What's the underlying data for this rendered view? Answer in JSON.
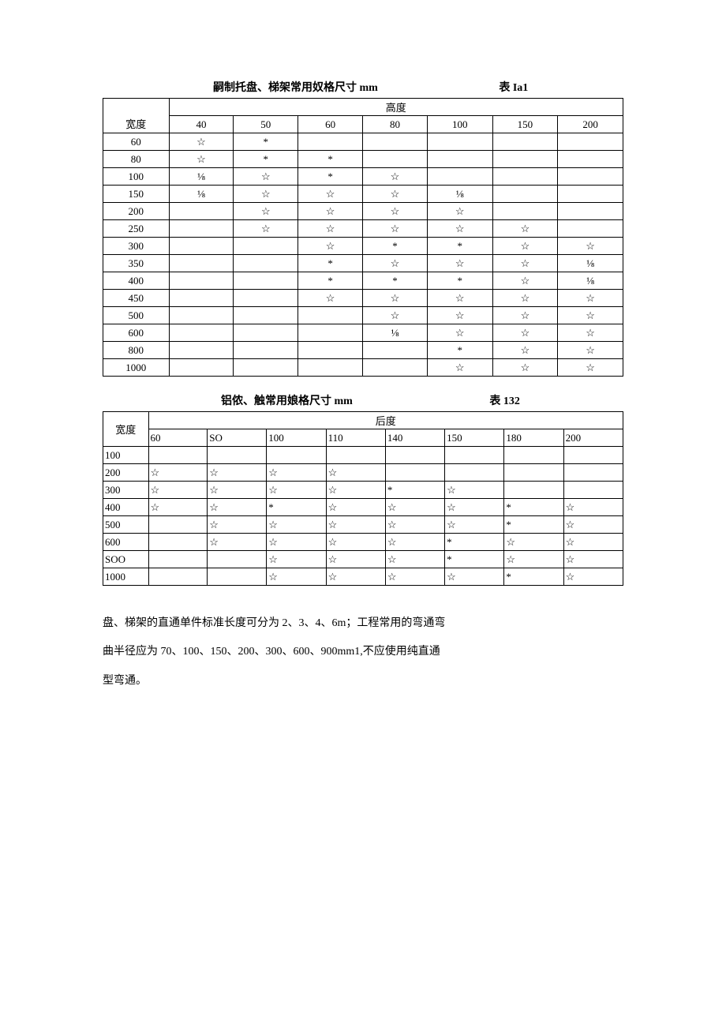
{
  "table1": {
    "title": "嗣制托盘、梯架常用奴格尺寸 mm",
    "label": "表 Ia1",
    "row_header_label": "宽度",
    "col_group_label": "高度",
    "columns": [
      "40",
      "50",
      "60",
      "80",
      "100",
      "150",
      "200"
    ],
    "rows": [
      {
        "w": "60",
        "c": [
          "☆",
          "*",
          "",
          "",
          "",
          "",
          ""
        ]
      },
      {
        "w": "80",
        "c": [
          "☆",
          "*",
          "*",
          "",
          "",
          "",
          ""
        ]
      },
      {
        "w": "100",
        "c": [
          "⅛",
          "☆",
          "*",
          "☆",
          "",
          "",
          ""
        ]
      },
      {
        "w": "150",
        "c": [
          "⅛",
          "☆",
          "☆",
          "☆",
          "⅛",
          "",
          ""
        ]
      },
      {
        "w": "200",
        "c": [
          "",
          "☆",
          "☆",
          "☆",
          "☆",
          "",
          ""
        ]
      },
      {
        "w": "250",
        "c": [
          "",
          "☆",
          "☆",
          "☆",
          "☆",
          "☆",
          ""
        ]
      },
      {
        "w": "300",
        "c": [
          "",
          "",
          "☆",
          "*",
          "*",
          "☆",
          "☆"
        ]
      },
      {
        "w": "350",
        "c": [
          "",
          "",
          "*",
          "☆",
          "☆",
          "☆",
          "⅛"
        ]
      },
      {
        "w": "400",
        "c": [
          "",
          "",
          "*",
          "*",
          "*",
          "☆",
          "⅛"
        ]
      },
      {
        "w": "450",
        "c": [
          "",
          "",
          "☆",
          "☆",
          "☆",
          "☆",
          "☆"
        ]
      },
      {
        "w": "500",
        "c": [
          "",
          "",
          "",
          "☆",
          "☆",
          "☆",
          "☆"
        ]
      },
      {
        "w": "600",
        "c": [
          "",
          "",
          "",
          "⅛",
          "☆",
          "☆",
          "☆"
        ]
      },
      {
        "w": "800",
        "c": [
          "",
          "",
          "",
          "",
          "*",
          "☆",
          "☆"
        ]
      },
      {
        "w": "1000",
        "c": [
          "",
          "",
          "",
          "",
          "☆",
          "☆",
          "☆"
        ]
      }
    ]
  },
  "table2": {
    "title": "铝侬、触常用娘格尺寸 mm",
    "label": "表 132",
    "row_header_label": "宽度",
    "col_group_label": "后度",
    "columns": [
      "60",
      "SO",
      "100",
      "110",
      "140",
      "150",
      "180",
      "200"
    ],
    "rows": [
      {
        "w": "100",
        "c": [
          "",
          "",
          "",
          "",
          "",
          "",
          "",
          ""
        ]
      },
      {
        "w": "200",
        "c": [
          "☆",
          "☆",
          "☆",
          "☆",
          "",
          "",
          "",
          ""
        ]
      },
      {
        "w": "300",
        "c": [
          "☆",
          "☆",
          "☆",
          "☆",
          "*",
          "☆",
          "",
          ""
        ]
      },
      {
        "w": "400",
        "c": [
          "☆",
          "☆",
          "*",
          "☆",
          "☆",
          "☆",
          "*",
          "☆"
        ]
      },
      {
        "w": "500",
        "c": [
          "",
          "☆",
          "☆",
          "☆",
          "☆",
          "☆",
          "*",
          "☆"
        ]
      },
      {
        "w": "600",
        "c": [
          "",
          "☆",
          "☆",
          "☆",
          "☆",
          "*",
          "☆",
          "☆"
        ]
      },
      {
        "w": "SOO",
        "c": [
          "",
          "",
          "☆",
          "☆",
          "☆",
          "*",
          "☆",
          "☆"
        ]
      },
      {
        "w": "1000",
        "c": [
          "",
          "",
          "☆",
          "☆",
          "☆",
          "☆",
          "*",
          "☆"
        ]
      }
    ]
  },
  "paragraphs": [
    "盘、梯架的直通单件标准长度可分为 2、3、4、6m；工程常用的弯通弯",
    "曲半径应为 70、100、150、200、300、600、900mm1,不应使用纯直通",
    "型弯通。"
  ]
}
